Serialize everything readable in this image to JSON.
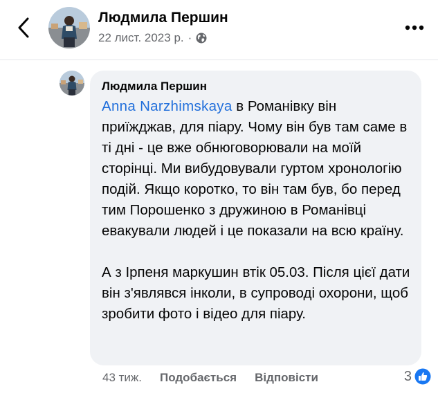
{
  "post_header": {
    "author_name": "Людмила Першин",
    "date": "22 лист. 2023 р.",
    "separator": "·",
    "audience_icon": "globe-icon"
  },
  "comment": {
    "author_name": "Людмила Першин",
    "mention": "Anna  Narzhimskaya",
    "paragraph1_rest": " в Романівку він приїжджав, для піару. Чому він був там саме в ті дні - це вже обнюговорювали на моїй сторінці. Ми вибудовували гуртом хронологію подій. Якщо коротко, то він там був, бо перед тим Порошенко з дружиною в Романівці евакували людей і це показали на всю країну.",
    "paragraph2": "А з Ірпеня маркушин втік 05.03. Після цієї дати він з'являвся інколи, в супроводі охорони, щоб зробити фото і відео для піару."
  },
  "comment_actions": {
    "time_ago": "43 тиж.",
    "like_label": "Подобається",
    "reply_label": "Відповісти",
    "reaction_count": "3",
    "reaction_icon": "like-icon"
  },
  "colors": {
    "mention": "#216fdb",
    "bubble_bg": "#f0f2f5",
    "meta_text": "#65676b",
    "like_blue": "#1877f2"
  }
}
